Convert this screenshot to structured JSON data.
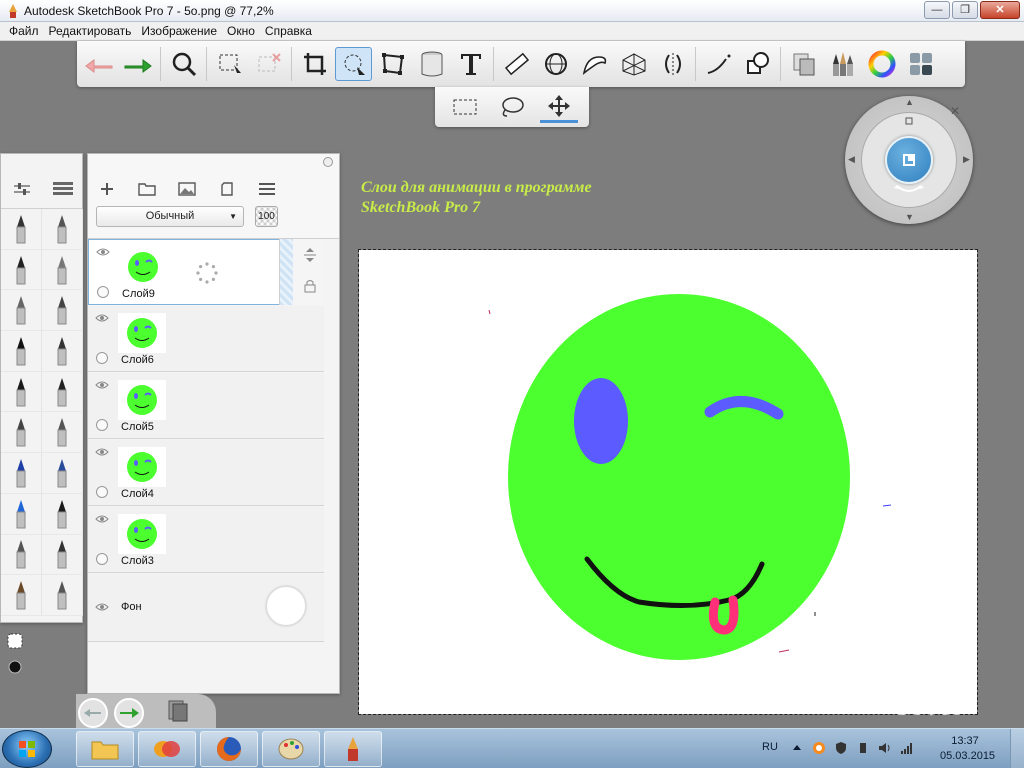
{
  "window": {
    "title": "Autodesk SketchBook Pro 7 - 5o.png @ 77,2%",
    "minimize": "—",
    "maximize": "❐",
    "close": "✕"
  },
  "menu": [
    "Файл",
    "Редактировать",
    "Изображение",
    "Окно",
    "Справка"
  ],
  "toolbar": {
    "tools": [
      "undo-icon",
      "redo-icon",
      "zoom-icon",
      "select-icon",
      "clear-selection-icon",
      "crop-icon",
      "lasso-transform-icon",
      "distort-icon",
      "fill-icon",
      "text-icon",
      "ruler-icon",
      "ellipse-guide-icon",
      "french-curve-icon",
      "perspective-icon",
      "symmetry-icon",
      "stroke-icon",
      "shape-icon",
      "copy-icon",
      "brushes-icon",
      "color-wheel-icon",
      "palette-icon"
    ],
    "active": "lasso-transform-icon"
  },
  "subtoolbar": {
    "tools": [
      "rect-select-icon",
      "lasso-icon",
      "move-icon"
    ],
    "active": "move-icon"
  },
  "layers_panel": {
    "blend_mode": "Обычный",
    "opacity": "100",
    "layers": [
      {
        "name": "Слой9",
        "selected": true
      },
      {
        "name": "Слой6",
        "selected": false
      },
      {
        "name": "Слой5",
        "selected": false
      },
      {
        "name": "Слой4",
        "selected": false
      },
      {
        "name": "Слой3",
        "selected": false
      }
    ],
    "background_layer": "Фон"
  },
  "caption": {
    "line1": "Слои для анимации в программе",
    "line2": "SketchBook Pro 7"
  },
  "canvas": {
    "face_color": "#4cff2e",
    "eye_color": "#5b5bff",
    "tongue_color": "#ff2f7a"
  },
  "taskbar": {
    "lang": "RU",
    "time": "13:37",
    "date": "05.03.2015"
  }
}
